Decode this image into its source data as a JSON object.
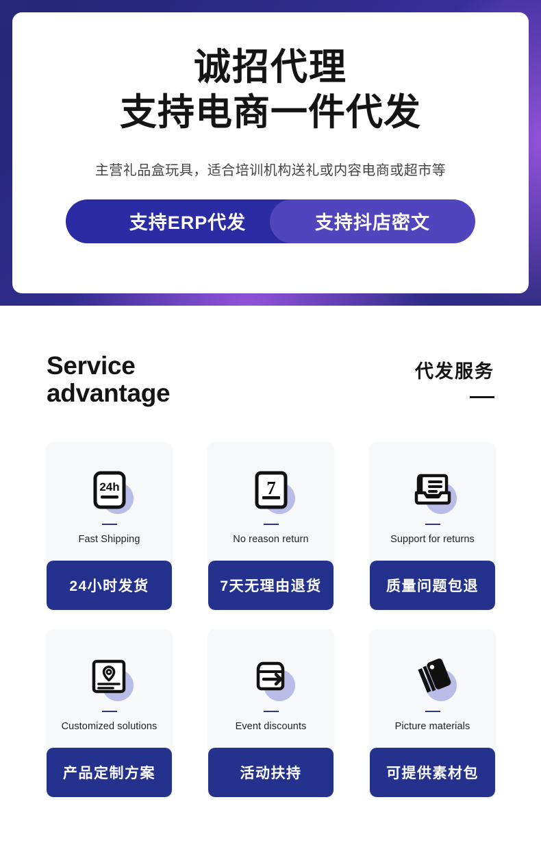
{
  "hero": {
    "title_line1": "诚招代理",
    "title_line2": "支持电商一件代发",
    "subtitle": "主营礼品盒玩具，适合培训机构送礼或内容电商或超市等",
    "pill_left": "支持ERP代发",
    "pill_right": "支持抖店密文",
    "colors": {
      "gradient_dark": "#232479",
      "gradient_purple": "#9655dc",
      "pill_left_bg": "#2b2ba4",
      "pill_right_bg": "#5045bd"
    }
  },
  "section": {
    "en_line1": "Service",
    "en_line2": "advantage",
    "cn_title": "代发服务"
  },
  "cards": [
    {
      "icon": "calendar-24h-icon",
      "icon_text": "24h",
      "en": "Fast Shipping",
      "cn": "24小时发货"
    },
    {
      "icon": "calendar-7day-icon",
      "icon_text": "7",
      "en": "No reason return",
      "cn": "7天无理由退货"
    },
    {
      "icon": "inbox-document-icon",
      "icon_text": "",
      "en": "Support for returns",
      "cn": "质量问题包退"
    },
    {
      "icon": "document-location-pin-icon",
      "icon_text": "",
      "en": "Customized solutions",
      "cn": "产品定制方案"
    },
    {
      "icon": "box-arrow-right-icon",
      "icon_text": "",
      "en": "Event discounts",
      "cn": "活动扶持"
    },
    {
      "icon": "tag-stack-icon",
      "icon_text": "",
      "en": "Picture materials",
      "cn": "可提供素材包"
    }
  ],
  "theme": {
    "card_bg": "#f7f8fa",
    "banner_bg": "#24318d",
    "blob": "#b9bce6",
    "divider": "#2b357f"
  }
}
